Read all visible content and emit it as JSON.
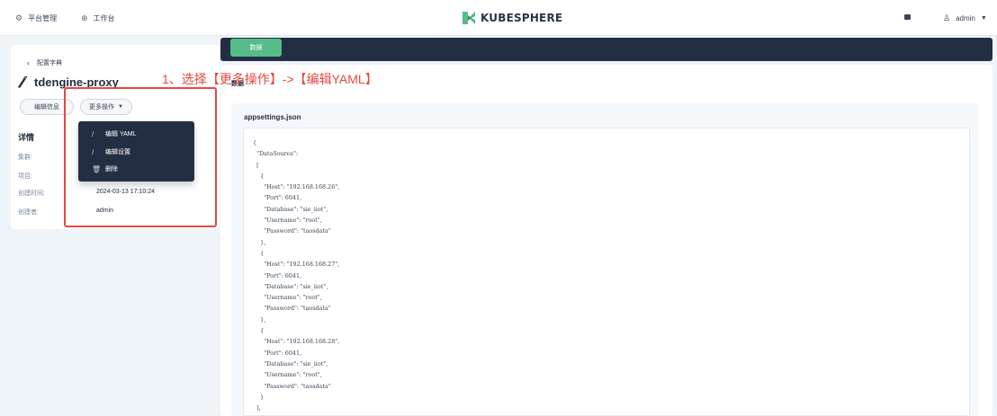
{
  "topbar": {
    "platform_label": "平台管理",
    "platform_icon": "gear-icon",
    "workbench_label": "工作台",
    "workbench_icon": "workbench-icon",
    "brand": "KUBESPHERE",
    "user_label": "admin"
  },
  "detail": {
    "back_label": "配置字典",
    "name": "tdengine-proxy",
    "edit_info_label": "编辑信息",
    "more_actions_label": "更多操作",
    "section_title": "详情",
    "fields": [
      {
        "key": "集群:",
        "value": ""
      },
      {
        "key": "项目:",
        "value": ""
      },
      {
        "key": "创建时间:",
        "value": "2024-03-13 17:10:24"
      },
      {
        "key": "创建者:",
        "value": "admin"
      }
    ]
  },
  "dropdown": {
    "items": [
      {
        "label": "编辑 YAML",
        "icon": "edit-icon"
      },
      {
        "label": "编辑设置",
        "icon": "edit-icon"
      },
      {
        "label": "删除",
        "icon": "trash-icon"
      }
    ]
  },
  "annotation": {
    "text": "1、选择【更多操作】->【编辑YAML】"
  },
  "main": {
    "tab_label": "数据",
    "section_title": "数据",
    "file_name": "appsettings.json",
    "code_lines": [
      "{",
      "  \"DataSource\":",
      "  [",
      "    {",
      "      \"Host\": \"192.168.168.26\",",
      "      \"Port\": 6041,",
      "      \"Database\": \"sie_iiot\",",
      "      \"Username\": \"root\",",
      "      \"Password\": \"taosdata\"",
      "    },",
      "    {",
      "      \"Host\": \"192.168.168.27\",",
      "      \"Port\": 6041,",
      "      \"Database\": \"sie_iiot\",",
      "      \"Username\": \"root\",",
      "      \"Password\": \"taosdata\"",
      "    },",
      "    {",
      "      \"Host\": \"192.168.168.28\",",
      "      \"Port\": 6041,",
      "      \"Database\": \"sie_iiot\",",
      "      \"Username\": \"root\",",
      "      \"Password\": \"taosdata\"",
      "    }",
      "  ],"
    ]
  },
  "colors": {
    "accent_green": "#55bc8a",
    "dark_navy": "#242e42",
    "annotation_red": "#e8473e"
  }
}
